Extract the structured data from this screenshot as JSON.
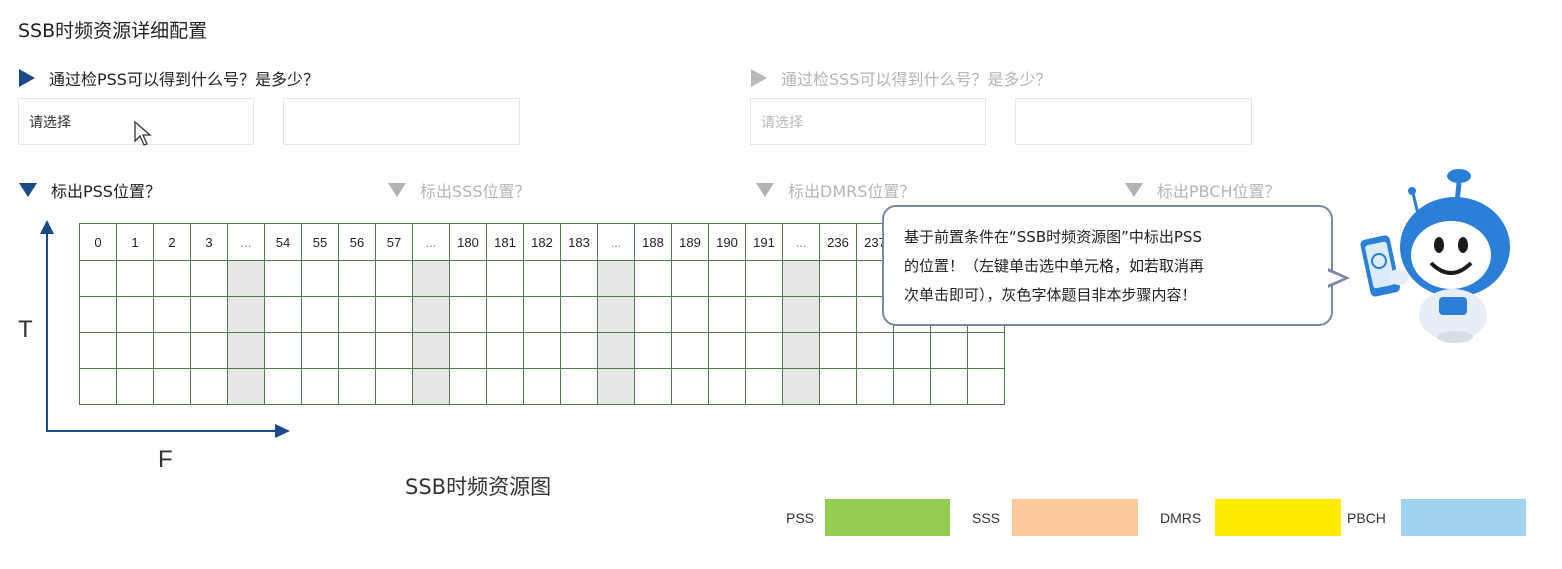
{
  "page_title": "SSB时频资源详细配置",
  "questions": {
    "pss": {
      "text": "通过检PSS可以得到什么号？是多少？",
      "select_value": "请选择",
      "value_box": ""
    },
    "sss": {
      "text": "通过检SSS可以得到什么号？是多少？",
      "select_value": "请选择",
      "value_box": ""
    }
  },
  "mark_tabs": [
    "标出PSS位置？",
    "标出SSS位置？",
    "标出DMRS位置？",
    "标出PBCH位置？"
  ],
  "grid": {
    "header": [
      "0",
      "1",
      "2",
      "3",
      "...",
      "54",
      "55",
      "56",
      "57",
      "...",
      "180",
      "181",
      "182",
      "183",
      "...",
      "188",
      "189",
      "190",
      "191",
      "...",
      "236",
      "237",
      "",
      "",
      ""
    ],
    "gap_columns": [
      4,
      9,
      14,
      19
    ],
    "body_rows": 4
  },
  "axes": {
    "t_label": "T",
    "f_label": "F"
  },
  "caption": "SSB时频资源图",
  "tooltip": {
    "lines": [
      "基于前置条件在“SSB时频资源图”中标出PSS",
      "的位置！（左键单击选中单元格，如若取消再",
      "次单击即可），灰色字体题目非本步骤内容！"
    ]
  },
  "legend": [
    {
      "label": "PSS",
      "color": "#92cc50"
    },
    {
      "label": "SSS",
      "color": "#fbc99a"
    },
    {
      "label": "DMRS",
      "color": "#ffeb00"
    },
    {
      "label": "PBCH",
      "color": "#9fd3ee"
    }
  ],
  "colors": {
    "accent": "#1a4a8a",
    "grid_line": "#4f7a4f",
    "gap_fill": "#e6e6e6"
  }
}
